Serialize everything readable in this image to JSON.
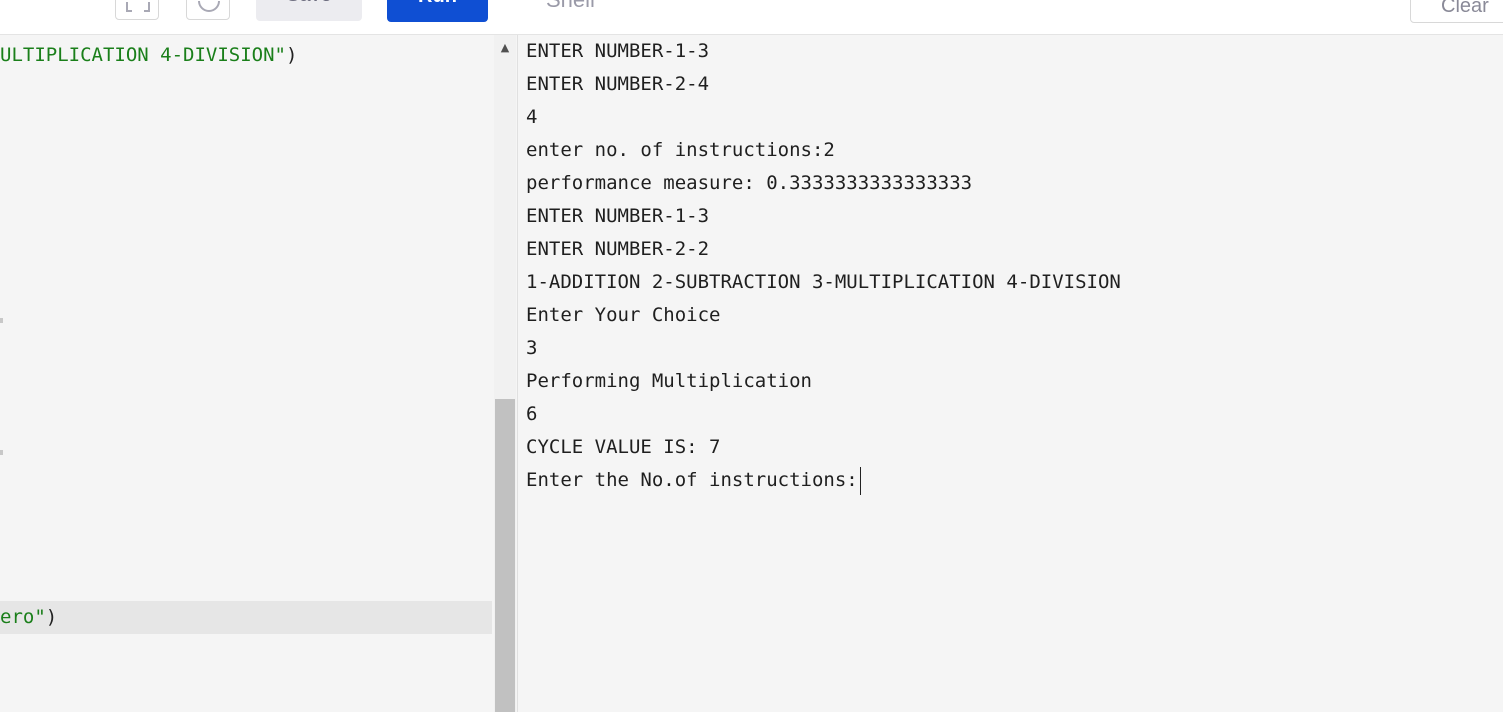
{
  "toolbar": {
    "save_label": "Save",
    "run_label": "Run",
    "shell_label": "Shell",
    "clear_label": "Clear",
    "accent_color": "#0f4fd3"
  },
  "editor": {
    "lines": [
      {
        "str": "ULTIPLICATION 4-DIVISION\"",
        "rest": ")"
      },
      {
        "str": "ero\"",
        "rest": ")"
      }
    ]
  },
  "shell": {
    "output": [
      "ENTER NUMBER-1-3",
      "ENTER NUMBER-2-4",
      "4",
      "enter no. of instructions:2",
      "performance measure: 0.3333333333333333",
      "ENTER NUMBER-1-3",
      "ENTER NUMBER-2-2",
      "1-ADDITION 2-SUBTRACTION 3-MULTIPLICATION 4-DIVISION",
      "Enter Your Choice",
      "3",
      "Performing Multiplication",
      "6",
      "CYCLE VALUE IS: 7"
    ],
    "prompt": "Enter the No.of instructions:"
  }
}
